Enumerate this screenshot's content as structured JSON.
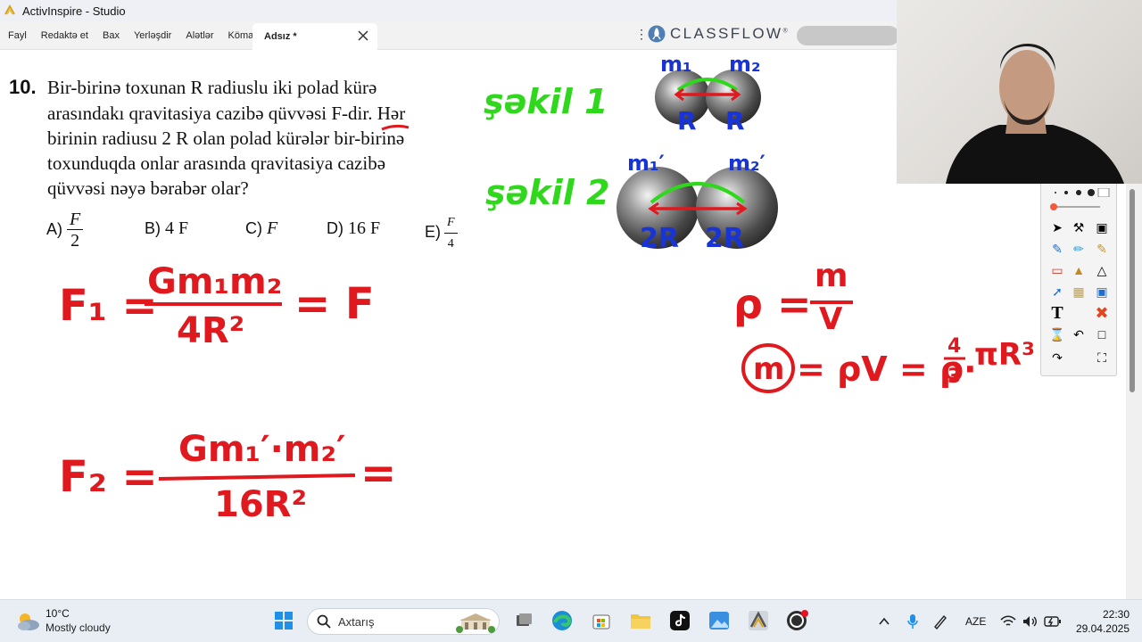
{
  "window": {
    "title": "ActivInspire - Studio"
  },
  "menu": {
    "items": [
      "Fayl",
      "Redaktə et",
      "Bax",
      "Yerləşdir",
      "Alətlər",
      "Kömak"
    ],
    "tab_label": "Adsız *",
    "brand": "CLASSFLOW",
    "brand_mark": "®"
  },
  "question": {
    "number": "10.",
    "lines": [
      "Bir-birinə toxunan R radiuslu iki polad kürə",
      "arasındakı qravitasiya cazibə qüvvəsi F-dir. Hər",
      "birinin radiusu 2 R olan polad kürələr bir-birinə",
      "toxunduqda onlar arasında qravitasiya cazibə",
      "qüvvəsi nəyə bərabər olar?"
    ],
    "options": [
      {
        "letter": "A)",
        "num": "F",
        "den": "2"
      },
      {
        "letter": "B)",
        "text": "4 F"
      },
      {
        "letter": "C)",
        "text": "F"
      },
      {
        "letter": "D)",
        "text": "16 F"
      },
      {
        "letter": "E)",
        "num": "F",
        "den": "4"
      }
    ]
  },
  "annotations": {
    "fig1": "şəkil 1",
    "fig2": "şəkil 2",
    "m1": "m₁",
    "m2": "m₂",
    "m1p": "m₁′",
    "m2p": "m₂′",
    "r": "R",
    "r2": "2R",
    "f1_lhs": "F₁ =",
    "f1_num": "Gm₁m₂",
    "f1_den": "4R²",
    "f1_rhs": "= F",
    "f2_lhs": "F₂ =",
    "f2_num": "Gm₁′·m₂′",
    "f2_den": "16R²",
    "f2_rhs": "=",
    "rho_lhs": "ρ =",
    "rho_num": "m",
    "rho_den": "V",
    "mass_m": "m",
    "mass_rest": "= ρV = ρ·",
    "mass_frac_num": "4",
    "mass_frac_den": "3",
    "mass_tail": "πR³"
  },
  "colors": {
    "ink_red": "#e0191f",
    "ink_green": "#2fd81c",
    "ink_blue": "#1833d6"
  },
  "taskbar": {
    "temp": "10°C",
    "weather": "Mostly cloudy",
    "search_placeholder": "Axtarış",
    "lang": "AZE",
    "time": "22:30",
    "date": "29.04.2025"
  }
}
